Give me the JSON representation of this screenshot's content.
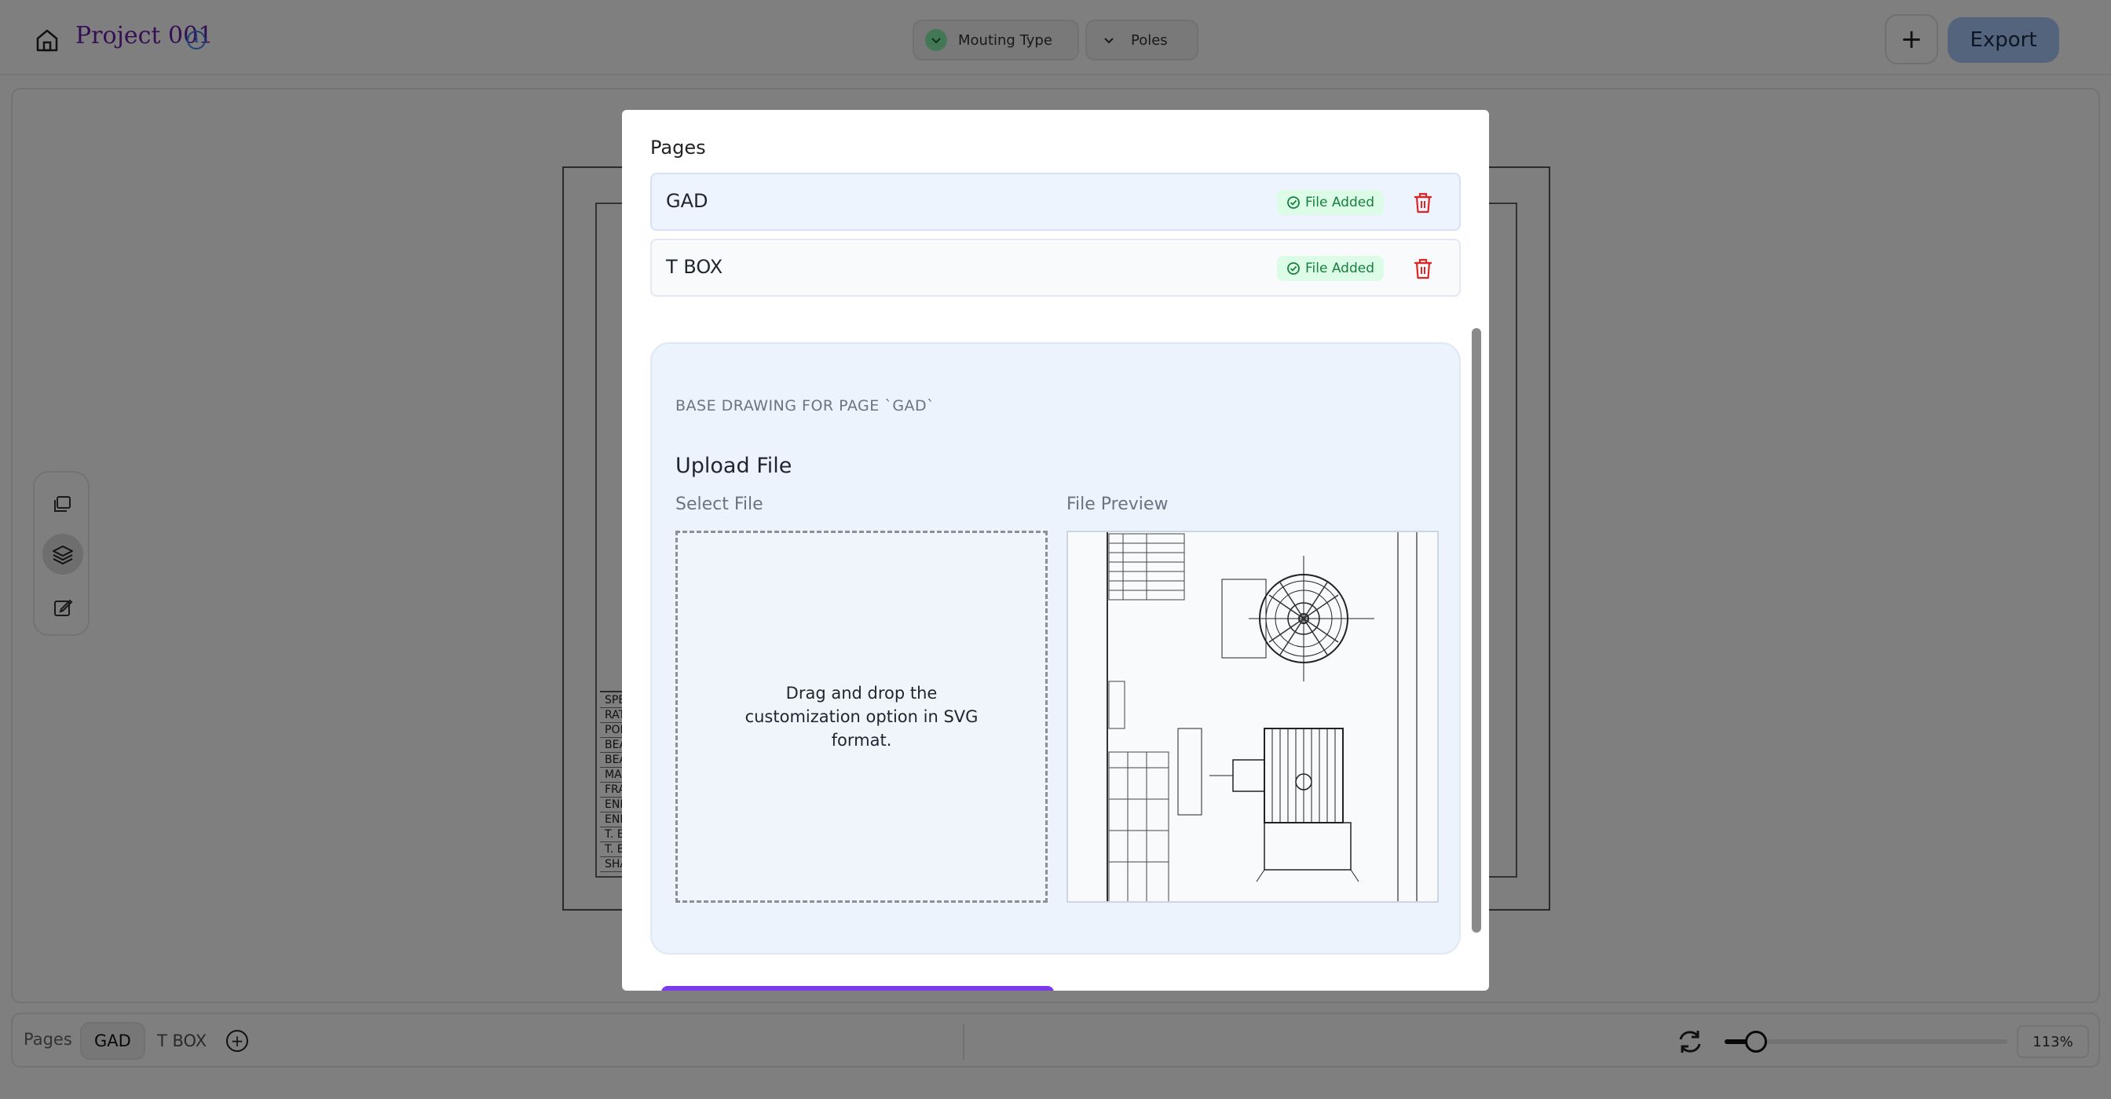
{
  "header": {
    "project_title": "Project 001",
    "filters": [
      {
        "label": "Mouting Type"
      },
      {
        "label": "Poles"
      }
    ],
    "export_label": "Export"
  },
  "drawing": {
    "spec_rows": [
      "SPE",
      "RAT",
      "POL",
      "BEA",
      "BEA",
      "MA",
      "FRA",
      "END",
      "END",
      "T. B",
      "T. B",
      "SHA"
    ]
  },
  "bottom_bar": {
    "pages_label": "Pages",
    "tabs": [
      "GAD",
      "T BOX"
    ],
    "active_tab": "GAD",
    "zoom": "113%",
    "zoom_fraction": 0.11
  },
  "modal": {
    "heading": "Pages",
    "pages": [
      {
        "name": "GAD",
        "status": "File Added",
        "selected": true
      },
      {
        "name": "T BOX",
        "status": "File Added",
        "selected": false
      }
    ],
    "section_title": "BASE DRAWING FOR PAGE `GAD`",
    "upload_title": "Upload File",
    "select_label": "Select File",
    "preview_label": "File Preview",
    "dropzone_text": "Drag and drop the customization option in SVG format."
  },
  "colors": {
    "accent_purple": "#6b21a8",
    "export_blue": "#a9c8f8",
    "badge_green": "#15803d",
    "trash_red": "#dc2626",
    "submit_purple": "#7c3aed"
  },
  "icons": [
    "home-icon",
    "info-icon",
    "chevron-down-icon",
    "plus-icon",
    "pages-icon",
    "layers-icon",
    "edit-icon",
    "add-circle-icon",
    "refresh-icon",
    "check-circle-icon",
    "trash-icon"
  ]
}
